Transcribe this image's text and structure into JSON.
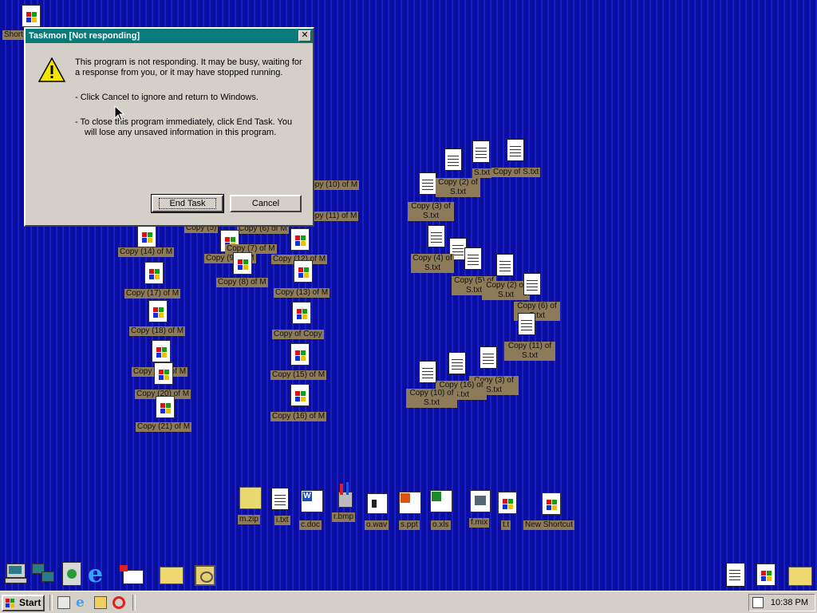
{
  "desktop": {
    "top_icon_label": "Short",
    "left_cluster": [
      {
        "label": "Copy (14) of M"
      },
      {
        "label": "Copy (17) of M"
      },
      {
        "label": "Copy (18) of M"
      },
      {
        "label": "Copy (19) of M"
      },
      {
        "label": "Copy (20) of M"
      },
      {
        "label": "Copy (21) of M"
      }
    ],
    "middle_cluster": [
      {
        "label": "Copy (5)"
      },
      {
        "label": "Copy (6) of M"
      },
      {
        "label": "Copy (7) of M"
      },
      {
        "label": "Copy (8) of M"
      },
      {
        "label": "Copy (12) of M"
      },
      {
        "label": "Copy (13) of M"
      },
      {
        "label": "Copy of Copy"
      },
      {
        "label": "Copy (15) of M"
      },
      {
        "label": "Copy (16) of M"
      },
      {
        "label": "Copy (9) of M"
      },
      {
        "label": "Copy (10) of M"
      },
      {
        "label": "Copy (11) of M"
      }
    ],
    "right_cluster": [
      {
        "label": "S.txt"
      },
      {
        "label": "Copy of S.txt"
      },
      {
        "label": "Copy (2) of S.txt"
      },
      {
        "label": "Copy (3) of S.txt"
      },
      {
        "label": "Copy (4) of S.txt"
      },
      {
        "label": "Copy (5) of S.txt"
      },
      {
        "label": "Copy (2) of S.txt"
      },
      {
        "label": "Copy (6) of S.txt"
      },
      {
        "label": "Copy (11) of S.txt"
      },
      {
        "label": "Copy (16) of S.txt"
      },
      {
        "label": "Copy (3) of S.txt"
      },
      {
        "label": "Copy (10) of S.txt"
      }
    ],
    "file_row": [
      {
        "label": "m.zip",
        "icon": "zip-icon"
      },
      {
        "label": "i.txt",
        "icon": "txt-icon"
      },
      {
        "label": "c.doc",
        "icon": "word-icon"
      },
      {
        "label": "r.bmp",
        "icon": "paint-icon"
      },
      {
        "label": "o.wav",
        "icon": "sound-icon"
      },
      {
        "label": "s.ppt",
        "icon": "powerpoint-icon"
      },
      {
        "label": "o.xls",
        "icon": "excel-icon"
      },
      {
        "label": "f.mix",
        "icon": "mix-icon"
      },
      {
        "label": "t.t",
        "icon": "windows-doc-icon"
      },
      {
        "label": "New Shortcut",
        "icon": "windows-doc-icon"
      }
    ]
  },
  "dialog": {
    "title": "Taskmon [Not responding]",
    "close_glyph": "✕",
    "message_1": "This program is not responding. It may be busy, waiting for a response from you, or it may have stopped running.",
    "message_2": "-   Click Cancel to ignore and return to Windows.",
    "message_3": "-   To close this program immediately, click End Task. You will lose any unsaved information in this program.",
    "end_task_label": "End Task",
    "cancel_label": "Cancel"
  },
  "taskbar": {
    "start_label": "Start",
    "clock": "10:38 PM"
  },
  "colors": {
    "desktop": "#0c10a8",
    "titlebar": "#0a7a7a",
    "label_bg": "#8c7a59",
    "face": "#d4d0c8"
  }
}
